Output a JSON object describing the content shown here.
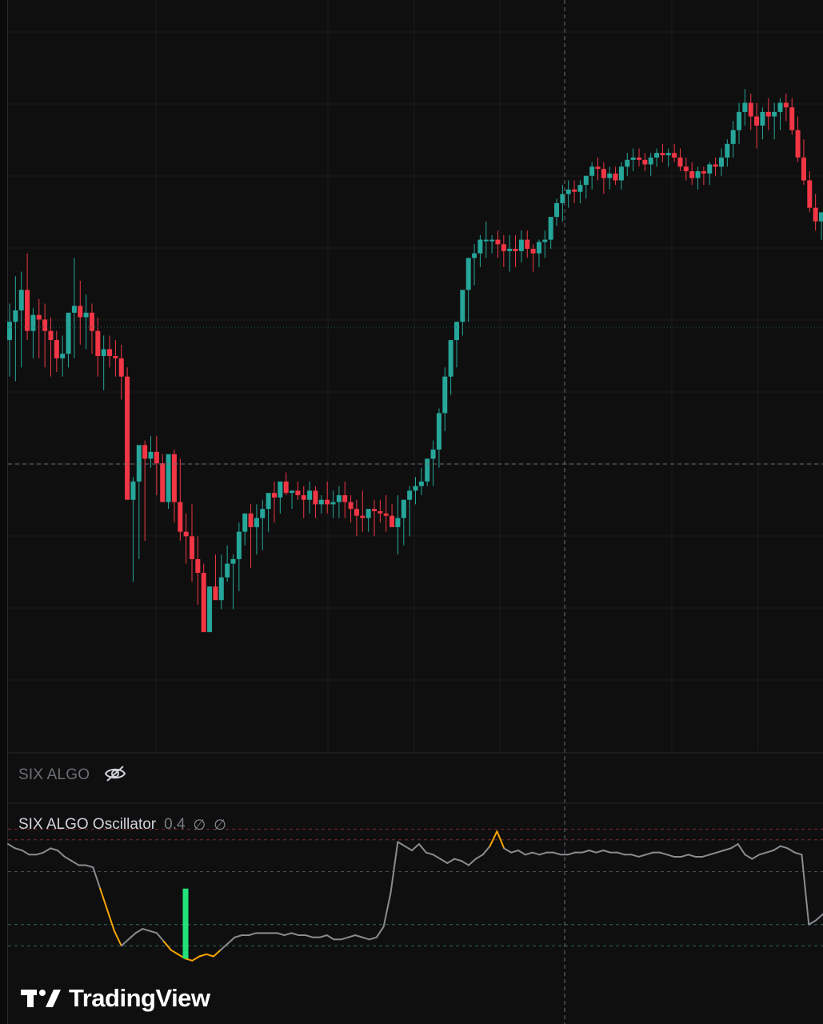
{
  "main_pane": {
    "type": "candlestick",
    "candle_colors": {
      "up": "#26a69a",
      "down": "#f23645"
    },
    "price_range": [
      0,
      1000
    ],
    "horizontal_line_levels": [
      586,
      425
    ],
    "candles": [
      [
        780,
        860,
        700,
        820
      ],
      [
        820,
        920,
        690,
        845
      ],
      [
        845,
        930,
        720,
        890
      ],
      [
        890,
        970,
        780,
        800
      ],
      [
        800,
        850,
        740,
        835
      ],
      [
        835,
        870,
        740,
        825
      ],
      [
        825,
        860,
        720,
        800
      ],
      [
        800,
        830,
        700,
        780
      ],
      [
        780,
        800,
        710,
        740
      ],
      [
        740,
        790,
        700,
        750
      ],
      [
        750,
        820,
        720,
        840
      ],
      [
        840,
        960,
        740,
        855
      ],
      [
        855,
        910,
        770,
        830
      ],
      [
        830,
        880,
        760,
        840
      ],
      [
        840,
        860,
        750,
        800
      ],
      [
        800,
        830,
        700,
        745
      ],
      [
        745,
        790,
        670,
        760
      ],
      [
        760,
        790,
        720,
        745
      ],
      [
        745,
        780,
        700,
        740
      ],
      [
        740,
        770,
        650,
        700
      ],
      [
        700,
        720,
        440,
        430
      ],
      [
        430,
        480,
        250,
        470
      ],
      [
        470,
        500,
        300,
        550
      ],
      [
        550,
        560,
        340,
        520
      ],
      [
        520,
        570,
        500,
        535
      ],
      [
        535,
        570,
        440,
        510
      ],
      [
        510,
        530,
        450,
        425
      ],
      [
        425,
        510,
        410,
        530
      ],
      [
        530,
        540,
        380,
        425
      ],
      [
        425,
        520,
        340,
        360
      ],
      [
        360,
        400,
        290,
        350
      ],
      [
        350,
        420,
        250,
        300
      ],
      [
        300,
        350,
        200,
        270
      ],
      [
        270,
        290,
        150,
        140
      ],
      [
        140,
        240,
        140,
        240
      ],
      [
        240,
        310,
        220,
        210
      ],
      [
        210,
        310,
        190,
        260
      ],
      [
        260,
        330,
        250,
        290
      ],
      [
        290,
        310,
        190,
        300
      ],
      [
        300,
        380,
        230,
        360
      ],
      [
        360,
        400,
        330,
        400
      ],
      [
        400,
        420,
        280,
        370
      ],
      [
        370,
        420,
        310,
        390
      ],
      [
        390,
        430,
        320,
        410
      ],
      [
        410,
        420,
        360,
        445
      ],
      [
        445,
        470,
        380,
        435
      ],
      [
        435,
        470,
        400,
        470
      ],
      [
        470,
        490,
        440,
        445
      ],
      [
        445,
        450,
        410,
        450
      ],
      [
        450,
        470,
        430,
        440
      ],
      [
        440,
        460,
        390,
        430
      ],
      [
        430,
        470,
        400,
        450
      ],
      [
        450,
        460,
        390,
        420
      ],
      [
        420,
        440,
        400,
        430
      ],
      [
        430,
        470,
        400,
        420
      ],
      [
        420,
        450,
        390,
        425
      ],
      [
        425,
        460,
        390,
        440
      ],
      [
        440,
        470,
        390,
        425
      ],
      [
        425,
        440,
        380,
        410
      ],
      [
        410,
        430,
        350,
        395
      ],
      [
        395,
        450,
        360,
        390
      ],
      [
        390,
        410,
        360,
        410
      ],
      [
        410,
        430,
        350,
        405
      ],
      [
        405,
        430,
        380,
        400
      ],
      [
        400,
        440,
        360,
        395
      ],
      [
        395,
        420,
        370,
        370
      ],
      [
        370,
        440,
        310,
        390
      ],
      [
        390,
        410,
        330,
        430
      ],
      [
        430,
        460,
        350,
        450
      ],
      [
        450,
        480,
        420,
        460
      ],
      [
        460,
        500,
        440,
        470
      ],
      [
        470,
        520,
        460,
        520
      ],
      [
        520,
        560,
        460,
        540
      ],
      [
        540,
        630,
        500,
        620
      ],
      [
        620,
        720,
        580,
        700
      ],
      [
        700,
        760,
        660,
        780
      ],
      [
        780,
        820,
        720,
        820
      ],
      [
        820,
        870,
        790,
        890
      ],
      [
        890,
        960,
        820,
        960
      ],
      [
        960,
        990,
        900,
        970
      ],
      [
        970,
        1010,
        940,
        1000
      ],
      [
        1000,
        1040,
        960,
        1000
      ],
      [
        1000,
        1010,
        970,
        1000
      ],
      [
        1000,
        1020,
        960,
        990
      ],
      [
        990,
        1010,
        940,
        975
      ],
      [
        975,
        1010,
        930,
        980
      ],
      [
        980,
        1010,
        940,
        975
      ],
      [
        975,
        1020,
        950,
        1000
      ],
      [
        1000,
        1020,
        960,
        980
      ],
      [
        980,
        990,
        930,
        970
      ],
      [
        970,
        1000,
        940,
        995
      ],
      [
        995,
        1020,
        960,
        1000
      ],
      [
        1000,
        1030,
        980,
        1050
      ],
      [
        1050,
        1090,
        1030,
        1080
      ],
      [
        1080,
        1120,
        1040,
        1100
      ],
      [
        1100,
        1130,
        1070,
        1110
      ],
      [
        1110,
        1130,
        1080,
        1105
      ],
      [
        1105,
        1130,
        1080,
        1120
      ],
      [
        1120,
        1140,
        1090,
        1140
      ],
      [
        1140,
        1170,
        1110,
        1160
      ],
      [
        1160,
        1180,
        1130,
        1155
      ],
      [
        1155,
        1170,
        1100,
        1135
      ],
      [
        1135,
        1160,
        1110,
        1145
      ],
      [
        1145,
        1160,
        1120,
        1130
      ],
      [
        1130,
        1170,
        1110,
        1160
      ],
      [
        1160,
        1190,
        1140,
        1175
      ],
      [
        1175,
        1200,
        1150,
        1180
      ],
      [
        1180,
        1200,
        1160,
        1175
      ],
      [
        1175,
        1190,
        1150,
        1165
      ],
      [
        1165,
        1190,
        1140,
        1180
      ],
      [
        1180,
        1200,
        1160,
        1190
      ],
      [
        1190,
        1210,
        1170,
        1185
      ],
      [
        1185,
        1200,
        1160,
        1190
      ],
      [
        1190,
        1210,
        1170,
        1180
      ],
      [
        1180,
        1200,
        1150,
        1160
      ],
      [
        1160,
        1180,
        1130,
        1150
      ],
      [
        1150,
        1170,
        1120,
        1135
      ],
      [
        1135,
        1160,
        1110,
        1150
      ],
      [
        1150,
        1160,
        1120,
        1145
      ],
      [
        1145,
        1170,
        1120,
        1165
      ],
      [
        1165,
        1180,
        1140,
        1160
      ],
      [
        1160,
        1200,
        1140,
        1180
      ],
      [
        1180,
        1220,
        1160,
        1210
      ],
      [
        1210,
        1260,
        1180,
        1240
      ],
      [
        1240,
        1300,
        1210,
        1280
      ],
      [
        1280,
        1330,
        1250,
        1300
      ],
      [
        1300,
        1320,
        1240,
        1270
      ],
      [
        1270,
        1300,
        1200,
        1250
      ],
      [
        1250,
        1290,
        1220,
        1280
      ],
      [
        1280,
        1310,
        1240,
        1270
      ],
      [
        1270,
        1300,
        1220,
        1280
      ],
      [
        1280,
        1310,
        1240,
        1300
      ],
      [
        1300,
        1320,
        1260,
        1290
      ],
      [
        1290,
        1310,
        1230,
        1240
      ],
      [
        1240,
        1270,
        1170,
        1180
      ],
      [
        1180,
        1220,
        1120,
        1130
      ],
      [
        1130,
        1150,
        1060,
        1070
      ],
      [
        1070,
        1100,
        1020,
        1040
      ],
      [
        1040,
        1060,
        1000,
        1060
      ]
    ]
  },
  "indicator_pane": {
    "label": "SIX ALGO",
    "visibility_icon": "eye-off-icon"
  },
  "oscillator_pane": {
    "title": "SIX ALGO Oscillator",
    "value": "0.4",
    "na_glyph_1": "∅",
    "na_glyph_2": "∅",
    "line_colors": {
      "normal": "#8a8c91",
      "extreme": "#f7a600",
      "signal_bar": "#22e07a"
    },
    "level_lines": {
      "upper_red_1": 0.9,
      "upper_red_2": 0.85,
      "mid_upper": 0.7,
      "mid_lower": 0.45,
      "lower_green": 0.35
    },
    "values": [
      0.83,
      0.81,
      0.8,
      0.78,
      0.78,
      0.79,
      0.81,
      0.8,
      0.77,
      0.75,
      0.73,
      0.73,
      0.72,
      0.62,
      0.52,
      0.42,
      0.35,
      0.38,
      0.41,
      0.43,
      0.42,
      0.41,
      0.37,
      0.33,
      0.31,
      0.29,
      0.28,
      0.3,
      0.31,
      0.3,
      0.33,
      0.36,
      0.39,
      0.4,
      0.4,
      0.41,
      0.41,
      0.41,
      0.41,
      0.4,
      0.41,
      0.4,
      0.4,
      0.39,
      0.39,
      0.4,
      0.38,
      0.38,
      0.39,
      0.4,
      0.39,
      0.38,
      0.39,
      0.44,
      0.6,
      0.84,
      0.82,
      0.8,
      0.83,
      0.79,
      0.78,
      0.76,
      0.74,
      0.76,
      0.75,
      0.73,
      0.76,
      0.78,
      0.82,
      0.89,
      0.81,
      0.79,
      0.8,
      0.78,
      0.79,
      0.78,
      0.79,
      0.79,
      0.78,
      0.78,
      0.79,
      0.79,
      0.8,
      0.79,
      0.8,
      0.79,
      0.79,
      0.78,
      0.78,
      0.77,
      0.78,
      0.79,
      0.79,
      0.78,
      0.77,
      0.77,
      0.78,
      0.77,
      0.77,
      0.78,
      0.79,
      0.8,
      0.81,
      0.83,
      0.78,
      0.76,
      0.78,
      0.79,
      0.8,
      0.82,
      0.81,
      0.79,
      0.78,
      0.45,
      0.47,
      0.5
    ],
    "extreme_ranges": [
      [
        13,
        16
      ],
      [
        22,
        30
      ],
      [
        68,
        70
      ]
    ],
    "signal_bar_index": 25,
    "signal_bar_value": 0.62
  },
  "branding": {
    "logo_text": "TradingView"
  }
}
